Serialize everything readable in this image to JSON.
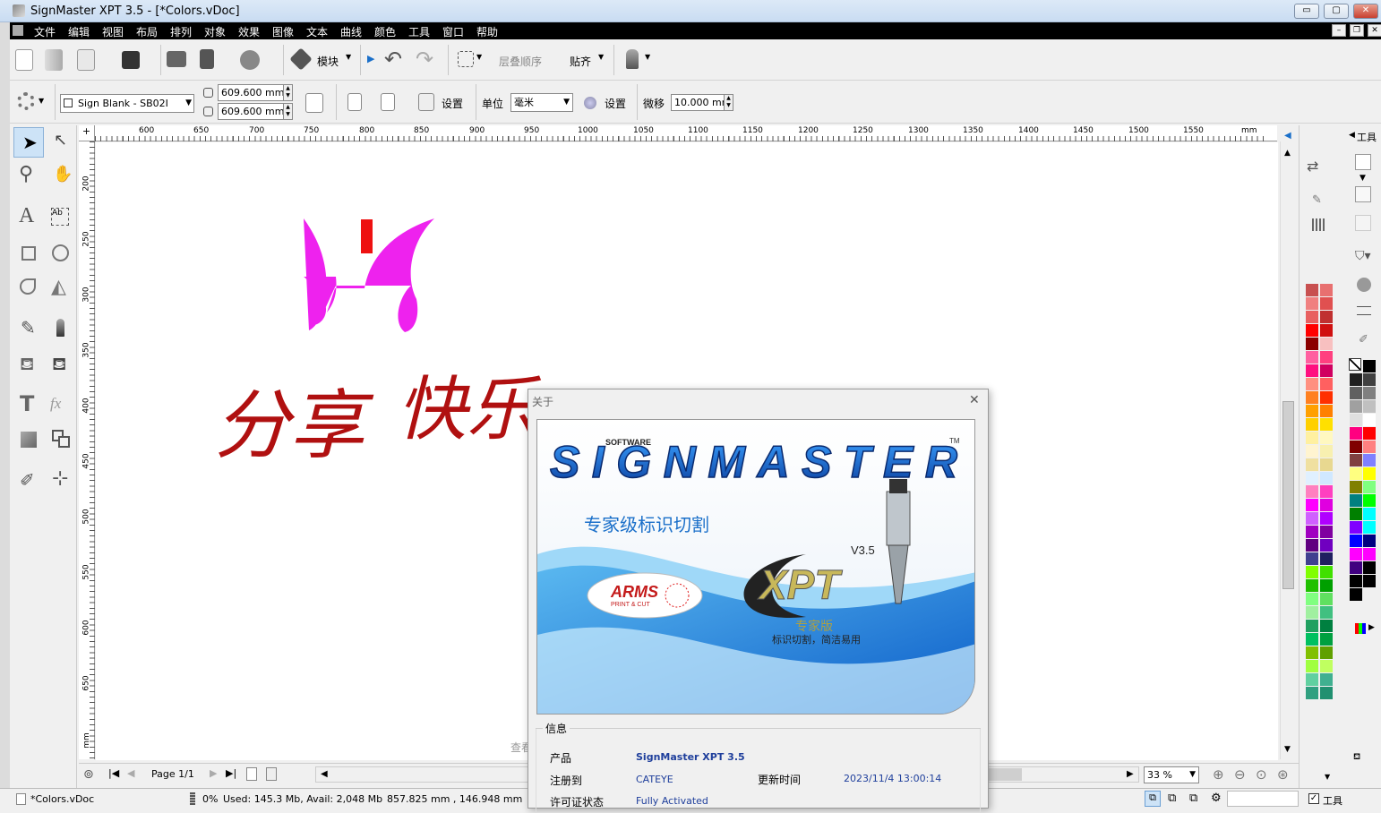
{
  "window": {
    "title": "SignMaster XPT 3.5 - [*Colors.vDoc]",
    "minimize": "▭",
    "maximize": "▢",
    "close": "✕"
  },
  "menu": [
    "文件",
    "编辑",
    "视图",
    "布局",
    "排列",
    "对象",
    "效果",
    "图像",
    "文本",
    "曲线",
    "颜色",
    "工具",
    "窗口",
    "帮助"
  ],
  "toolbar1": {
    "module_label": "模块",
    "layer_order_label": "层叠顺序",
    "snap_label": "贴齐"
  },
  "toolbar2": {
    "media_select": "Sign Blank - SB02I",
    "width_value": "609.600 mm",
    "height_value": "609.600 mm",
    "settings_label": "设置",
    "unit_label": "单位",
    "unit_value": "毫米",
    "settings2_label": "设置",
    "nudge_label": "微移",
    "nudge_value": "10.000 mm"
  },
  "ruler_top": [
    "600",
    "650",
    "700",
    "750",
    "800",
    "850",
    "900",
    "950",
    "1000",
    "1050",
    "1100",
    "1150",
    "1200",
    "1250",
    "1300",
    "1350",
    "1400",
    "1450",
    "1500",
    "1550",
    "mm"
  ],
  "ruler_left": [
    "200",
    "250",
    "300",
    "350",
    "400",
    "450",
    "500",
    "550",
    "600",
    "650",
    "mm"
  ],
  "right_panel": {
    "tab_label": "工具"
  },
  "nav": {
    "page": "Page 1/1",
    "zoom": "33 %"
  },
  "canvas_hint": "查看",
  "status": {
    "doc": "*Colors.vDoc",
    "progress": "0%",
    "memory": "Used: 145.3 Mb, Avail: 2,048 Mb",
    "coords": "857.825 mm , 146.948 mm",
    "tools_label": "工具"
  },
  "about": {
    "title": "关于",
    "close": "✕",
    "software_word": "SOFTWARE",
    "brand": "SIGNMASTER",
    "tm": "TM",
    "slogan": "专家级标识切割",
    "arms": "ARMS",
    "arms_sub": "PRINT & CUT",
    "version": "V3.5",
    "xpt": "XPT",
    "edition": "专家版",
    "tagline": "标识切割，简洁易用",
    "info_header": "信息",
    "product_label": "产品",
    "product_value": "SignMaster XPT 3.5",
    "registered_label": "注册到",
    "registered_value": "CATEYE",
    "update_label": "更新时间",
    "update_value": "2023/11/4 13:00:14",
    "license_label": "许可证状态",
    "license_value": "Fully Activated"
  },
  "colors": {
    "accent_blue": "#1a6fc9",
    "title_grad": "#c9dcf2",
    "magenta": "#ee22ee",
    "red_text": "#b01010",
    "swatches_left": [
      "#c85050",
      "#e87070",
      "#f08080",
      "#e05050",
      "#e86060",
      "#c03030",
      "#ff0000",
      "#d01010",
      "#8b0000",
      "#f8c0c0",
      "#ff60a0",
      "#ff4080",
      "#ff1080",
      "#d00060",
      "#ff9080",
      "#ff6060",
      "#ff8020",
      "#ff3000",
      "#ffa000",
      "#ff8000",
      "#ffd000",
      "#ffe000",
      "#fff0a0",
      "#fff8c0",
      "#fff4d0",
      "#f8f0b0",
      "#f0e0a0",
      "#e8d890",
      "#e0f0ff",
      "#d0e8ff",
      "#ff80c0",
      "#ff40c0",
      "#ff00ff",
      "#e000e0",
      "#d060ff",
      "#b000ff",
      "#a000c0",
      "#8000a0",
      "#600080",
      "#7000c0",
      "#404090",
      "#202060",
      "#80ff00",
      "#40e000",
      "#20c000",
      "#00a000",
      "#80ff80",
      "#60e060",
      "#a0f0a0",
      "#40c080",
      "#20a060",
      "#008040",
      "#00c060",
      "#00a040",
      "#80c000",
      "#60a000",
      "#a0ff40",
      "#c0ff60",
      "#60d0a0",
      "#40b090",
      "#30a080",
      "#209070"
    ],
    "swatches_right": [
      "#000000",
      "#202020",
      "#404040",
      "#606060",
      "#808080",
      "#a0a0a0",
      "#c0c0c0",
      "#e0e0e0",
      "#ffffff",
      "#ff0080",
      "#ff0000",
      "#800000",
      "#ff8080",
      "#804040",
      "#8080ff",
      "#ffff80",
      "#ffff00",
      "#808000",
      "#80ff80",
      "#008080",
      "#00ff00",
      "#008000",
      "#00ffff",
      "#8000ff",
      "#00ffff",
      "#0000ff",
      "#000080",
      "#ff00ff",
      "#ff00ff",
      "#400080",
      "#000000",
      "#000000",
      "#000000",
      "#000000"
    ]
  }
}
